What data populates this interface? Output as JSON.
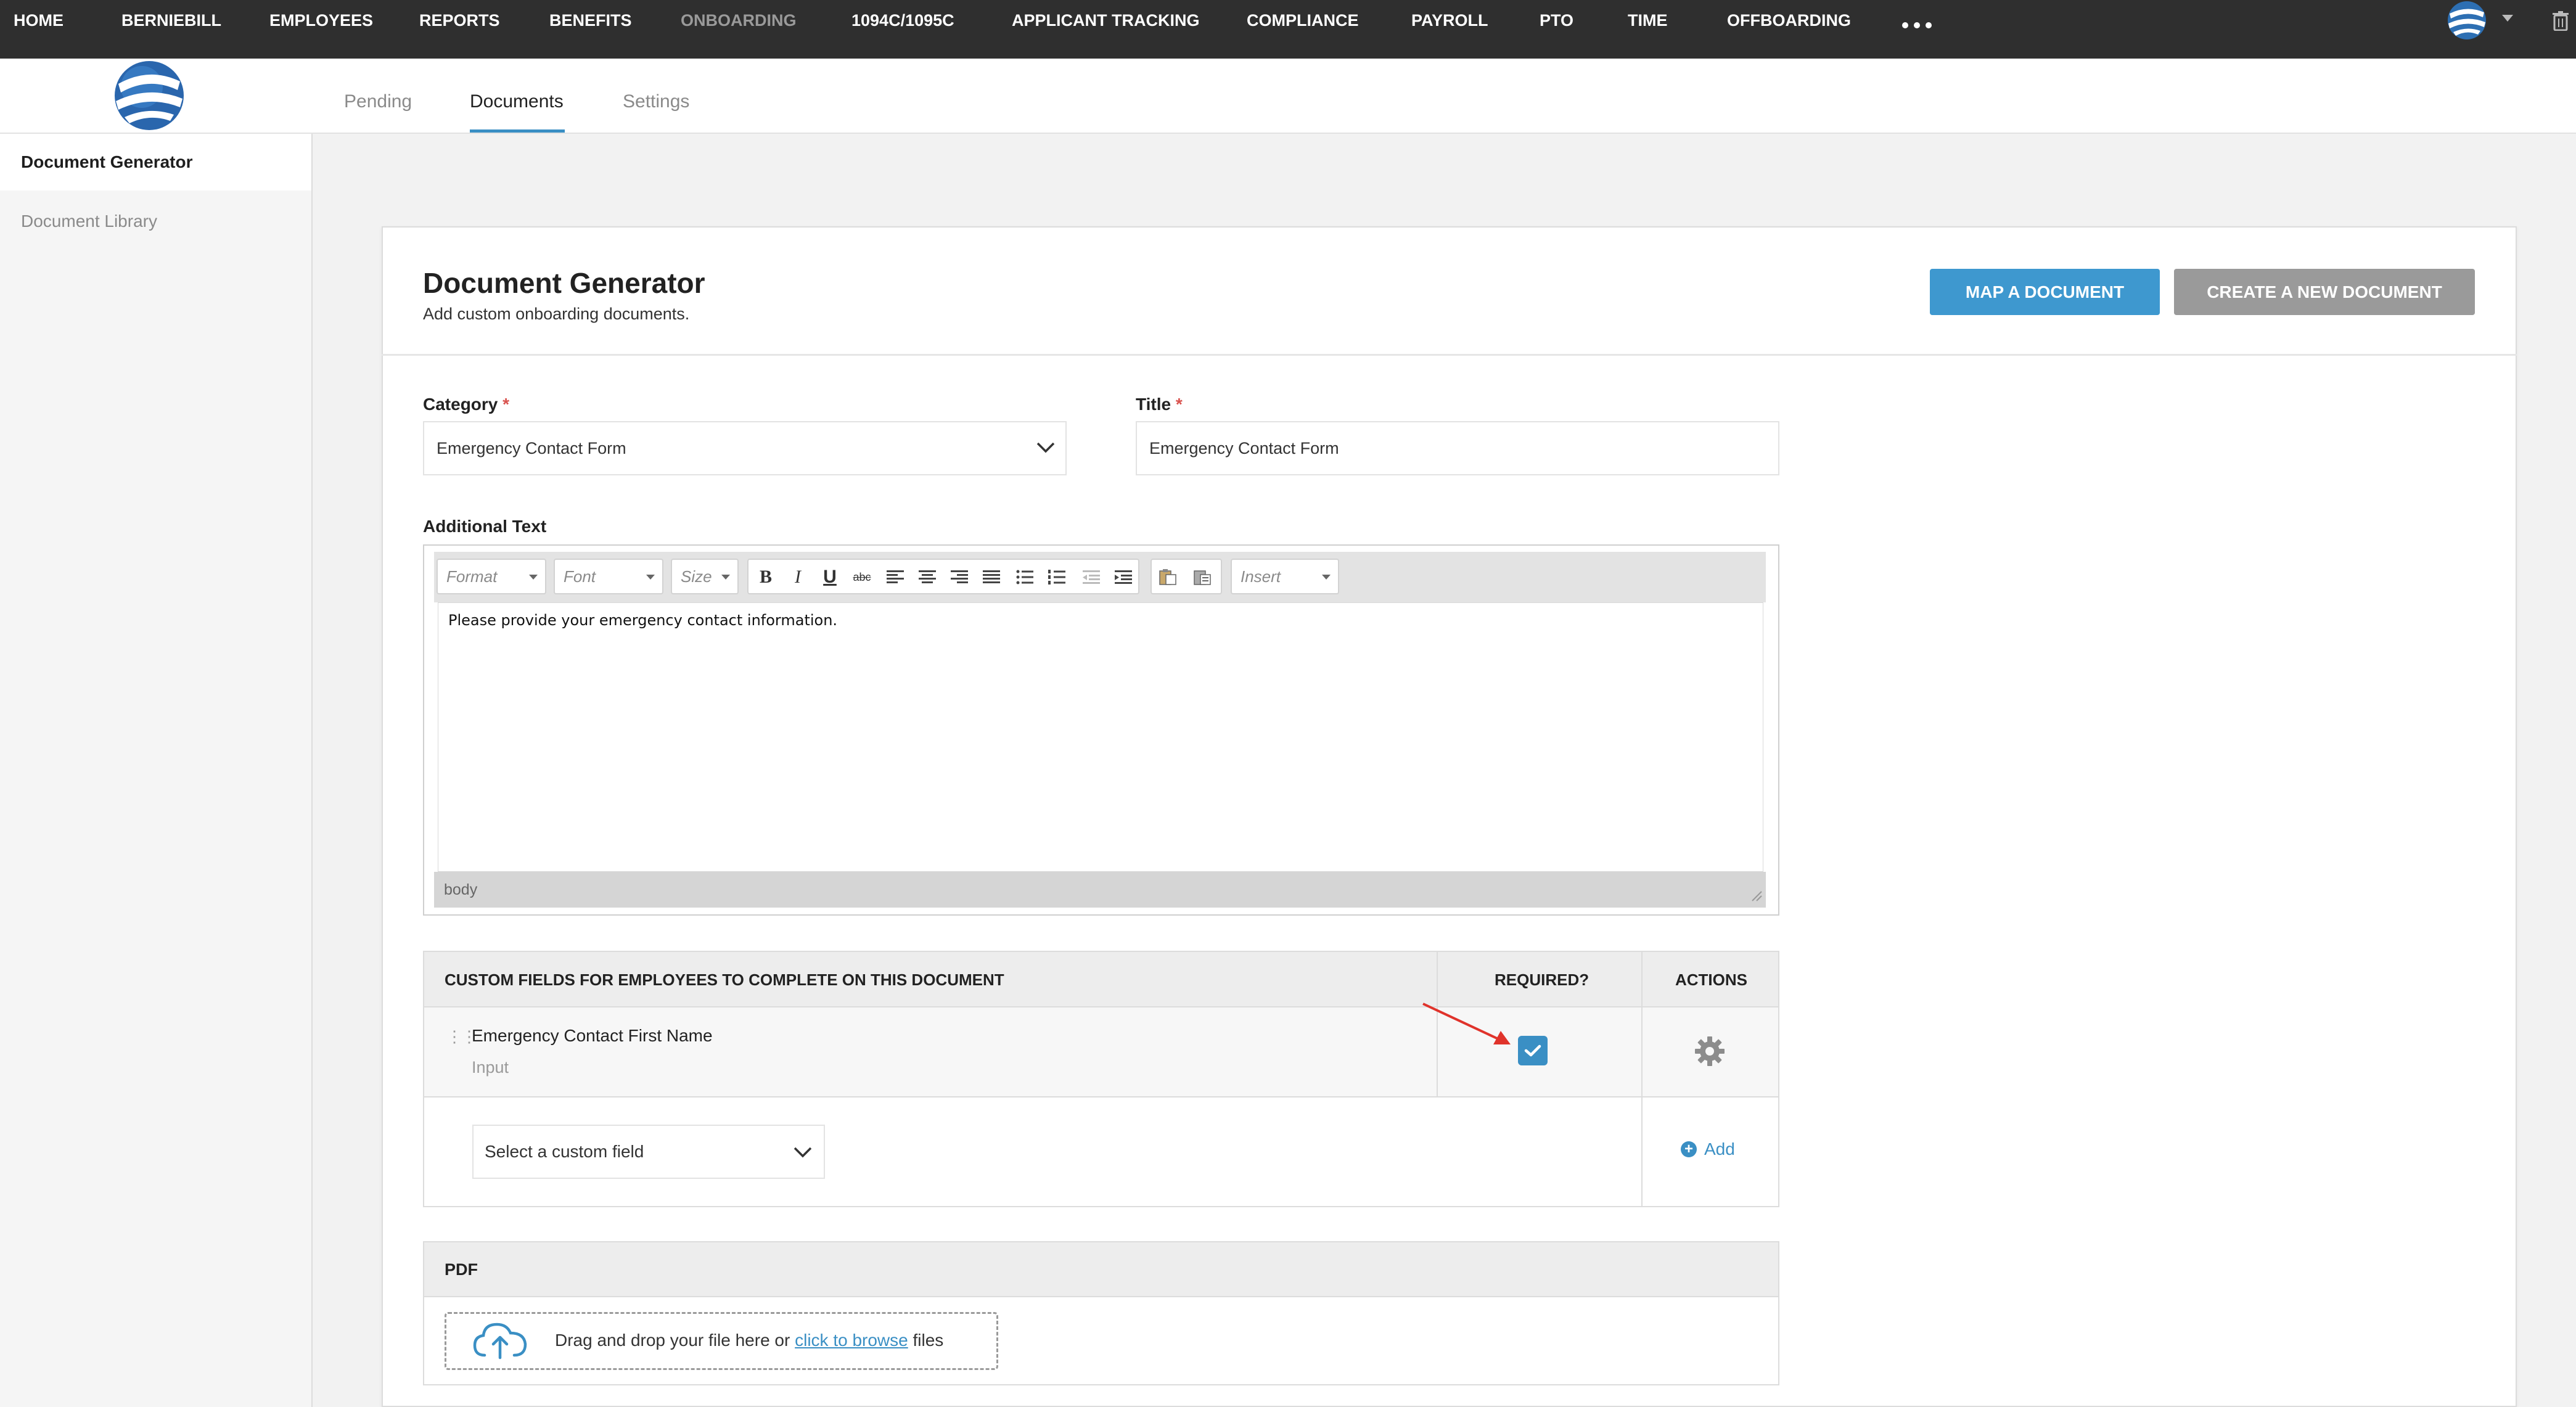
{
  "topnav": {
    "items": [
      {
        "label": "HOME",
        "active": false
      },
      {
        "label": "BERNIEBILL",
        "active": false
      },
      {
        "label": "EMPLOYEES",
        "active": false
      },
      {
        "label": "REPORTS",
        "active": false
      },
      {
        "label": "BENEFITS",
        "active": false
      },
      {
        "label": "ONBOARDING",
        "active": true
      },
      {
        "label": "1094C/1095C",
        "active": false
      },
      {
        "label": "APPLICANT TRACKING",
        "active": false
      },
      {
        "label": "COMPLIANCE",
        "active": false
      },
      {
        "label": "PAYROLL",
        "active": false
      },
      {
        "label": "PTO",
        "active": false
      },
      {
        "label": "TIME",
        "active": false
      },
      {
        "label": "OFFBOARDING",
        "active": false
      }
    ],
    "more_icon": "more-horizontal-icon",
    "account_icon": "globe-logo-icon",
    "trash_icon": "trash-icon"
  },
  "subtabs": [
    {
      "label": "Pending",
      "active": false
    },
    {
      "label": "Documents",
      "active": true
    },
    {
      "label": "Settings",
      "active": false
    }
  ],
  "sidebar": {
    "items": [
      {
        "label": "Document Generator",
        "active": true
      },
      {
        "label": "Document Library",
        "active": false
      }
    ]
  },
  "card": {
    "title": "Document Generator",
    "subtitle": "Add custom onboarding documents.",
    "map_button": "MAP A DOCUMENT",
    "create_button": "CREATE A NEW DOCUMENT"
  },
  "form": {
    "category_label": "Category",
    "category_value": "Emergency Contact Form",
    "title_label": "Title",
    "title_value": "Emergency Contact Form",
    "required_mark": "*",
    "additional_text_label": "Additional Text"
  },
  "editor": {
    "format_placeholder": "Format",
    "font_placeholder": "Font",
    "size_placeholder": "Size",
    "insert_placeholder": "Insert",
    "content": "Please provide your emergency contact information.",
    "status_path": "body"
  },
  "custom_fields": {
    "header_fields": "CUSTOM FIELDS FOR EMPLOYEES TO COMPLETE ON THIS DOCUMENT",
    "header_required": "REQUIRED?",
    "header_actions": "ACTIONS",
    "rows": [
      {
        "name": "Emergency Contact First Name",
        "type": "Input",
        "required": true
      }
    ],
    "select_placeholder": "Select a custom field",
    "add_label": "Add"
  },
  "pdf": {
    "label": "PDF",
    "drop_text_before": "Drag and drop your file here or",
    "browse_link": "click to browse",
    "drop_text_after": "files"
  },
  "colors": {
    "accent": "#3a8fc4",
    "nav_bg": "#2f2f2f",
    "secondary_button": "#9a9a9a",
    "required": "#d9534f"
  }
}
